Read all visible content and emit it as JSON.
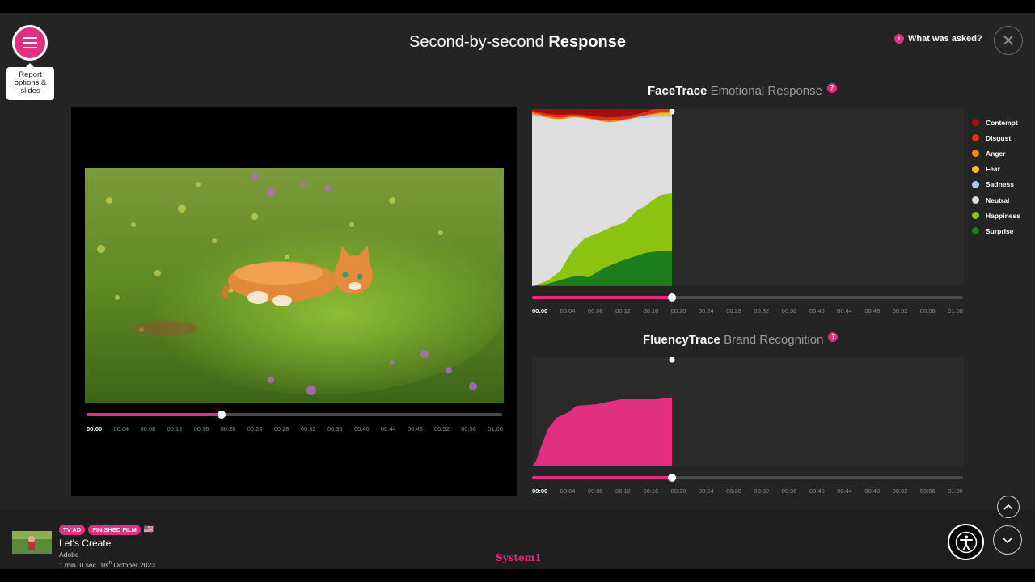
{
  "menu": {
    "tooltip": "Report options & slides"
  },
  "header": {
    "title_prefix": "Second-by-second",
    "title_bold": "Response",
    "asked_label": "What was asked?",
    "info_glyph": "i",
    "close_glyph": "✕"
  },
  "timeline_ticks": [
    "00:00",
    "00:04",
    "00:08",
    "00:12",
    "00:16",
    "00:20",
    "00:24",
    "00:28",
    "00:32",
    "00:36",
    "00:40",
    "00:44",
    "00:48",
    "00:52",
    "00:56",
    "01:00"
  ],
  "video": {
    "progress": 0.325
  },
  "facetrace": {
    "title_bold": "FaceTrace",
    "title_rest": "Emotional Response",
    "help_glyph": "?",
    "legend": [
      {
        "label": "Contempt",
        "color": "#a01010"
      },
      {
        "label": "Disgust",
        "color": "#e3301a"
      },
      {
        "label": "Anger",
        "color": "#f08a1c"
      },
      {
        "label": "Fear",
        "color": "#f2c21a"
      },
      {
        "label": "Sadness",
        "color": "#a9c8ec"
      },
      {
        "label": "Neutral",
        "color": "#dedede"
      },
      {
        "label": "Happiness",
        "color": "#8cc310"
      },
      {
        "label": "Surprise",
        "color": "#1b7d1b"
      }
    ],
    "progress": 0.325
  },
  "fluencytrace": {
    "title_bold": "FluencyTrace",
    "title_rest": "Brand Recognition",
    "help_glyph": "?",
    "progress": 0.325,
    "color": "#e0307f"
  },
  "film": {
    "badges": [
      "TV AD",
      "FINISHED FILM"
    ],
    "flag": "🇺🇸",
    "title": "Let's Create",
    "brand": "Adobe",
    "duration": "1 min. 0 sec.",
    "date_day": "18",
    "date_suffix": "th",
    "date_rest": "October 2023"
  },
  "logo": "System1",
  "colors": {
    "accent": "#e0307f",
    "background": "#242424"
  },
  "icons": {
    "menu": "hamburger-icon",
    "close": "close-icon",
    "accessibility": "accessibility-icon",
    "up": "chevron-up-icon",
    "down": "chevron-down-icon"
  }
}
